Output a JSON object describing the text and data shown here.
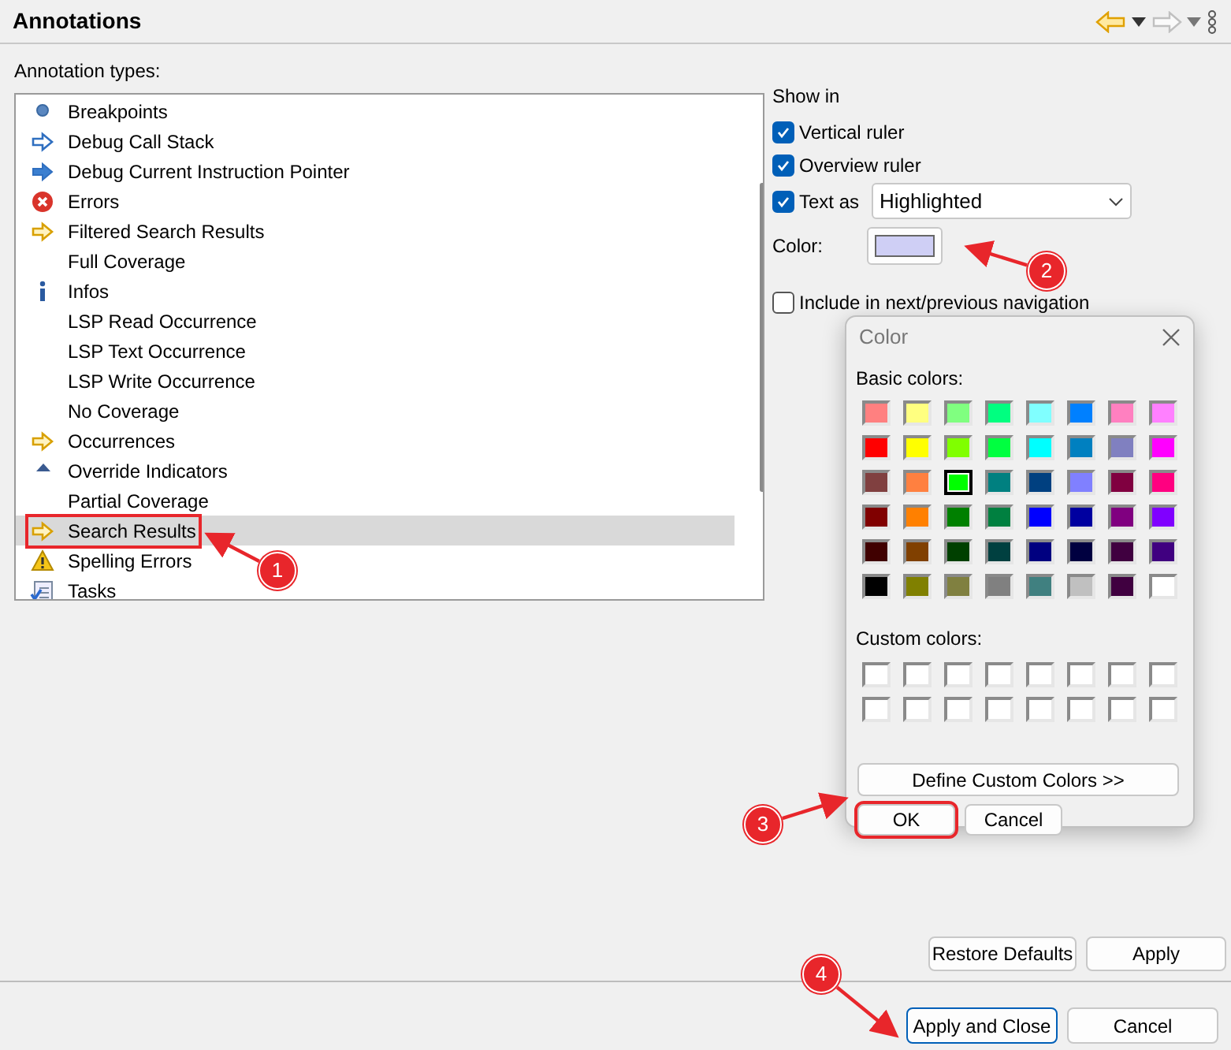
{
  "header": {
    "title": "Annotations"
  },
  "annotation_types": {
    "label": "Annotation types:",
    "items": [
      {
        "label": "Breakpoints",
        "kind": "dot",
        "selected": false,
        "highlighted": false
      },
      {
        "label": "Debug Call Stack",
        "kind": "arrow-outline",
        "selected": false,
        "highlighted": false
      },
      {
        "label": "Debug Current Instruction Pointer",
        "kind": "arrow-filled",
        "selected": false,
        "highlighted": false
      },
      {
        "label": "Errors",
        "kind": "error",
        "selected": false,
        "highlighted": false
      },
      {
        "label": "Filtered Search Results",
        "kind": "arrow-yellow",
        "selected": false,
        "highlighted": false
      },
      {
        "label": "Full Coverage",
        "kind": "plain",
        "selected": false,
        "highlighted": false
      },
      {
        "label": "Infos",
        "kind": "info",
        "selected": false,
        "highlighted": false
      },
      {
        "label": "LSP Read Occurrence",
        "kind": "plain",
        "selected": false,
        "highlighted": false
      },
      {
        "label": "LSP Text Occurrence",
        "kind": "plain",
        "selected": false,
        "highlighted": false
      },
      {
        "label": "LSP Write Occurrence",
        "kind": "plain",
        "selected": false,
        "highlighted": false
      },
      {
        "label": "No Coverage",
        "kind": "plain",
        "selected": false,
        "highlighted": false
      },
      {
        "label": "Occurrences",
        "kind": "arrow-yellow",
        "selected": false,
        "highlighted": false
      },
      {
        "label": "Override Indicators",
        "kind": "triangle",
        "selected": false,
        "highlighted": false
      },
      {
        "label": "Partial Coverage",
        "kind": "plain",
        "selected": false,
        "highlighted": false
      },
      {
        "label": "Search Results",
        "kind": "arrow-yellow",
        "selected": true,
        "highlighted": true
      },
      {
        "label": "Spelling Errors",
        "kind": "warning",
        "selected": false,
        "highlighted": false
      },
      {
        "label": "Tasks",
        "kind": "tasks",
        "selected": false,
        "highlighted": false
      }
    ]
  },
  "show_in": {
    "label": "Show in",
    "options": [
      {
        "kind": "plain",
        "label": "Vertical ruler",
        "checked": true
      },
      {
        "kind": "plain",
        "label": "Overview ruler",
        "checked": true
      },
      {
        "kind": "select",
        "label": "Text as",
        "checked": true,
        "value": "Highlighted"
      }
    ]
  },
  "color": {
    "label": "Color:",
    "color": "#cfcff5"
  },
  "include_navigation": {
    "label": "Include in next/previous navigation",
    "checked": false
  },
  "color_dialog": {
    "title": "Color",
    "basic_colors_label": "Basic colors:",
    "basic_colors": [
      {
        "color": "#ff8080",
        "selected": false
      },
      {
        "color": "#ffff80",
        "selected": false
      },
      {
        "color": "#80ff80",
        "selected": false
      },
      {
        "color": "#00ff80",
        "selected": false
      },
      {
        "color": "#80ffff",
        "selected": false
      },
      {
        "color": "#0080ff",
        "selected": false
      },
      {
        "color": "#ff80c0",
        "selected": false
      },
      {
        "color": "#ff80ff",
        "selected": false
      },
      {
        "color": "#ff0000",
        "selected": false
      },
      {
        "color": "#ffff00",
        "selected": false
      },
      {
        "color": "#80ff00",
        "selected": false
      },
      {
        "color": "#00ff40",
        "selected": false
      },
      {
        "color": "#00ffff",
        "selected": false
      },
      {
        "color": "#0080c0",
        "selected": false
      },
      {
        "color": "#8080c0",
        "selected": false
      },
      {
        "color": "#ff00ff",
        "selected": false
      },
      {
        "color": "#804040",
        "selected": false
      },
      {
        "color": "#ff8040",
        "selected": false
      },
      {
        "color": "#00ff00",
        "selected": true
      },
      {
        "color": "#008080",
        "selected": false
      },
      {
        "color": "#004080",
        "selected": false
      },
      {
        "color": "#8080ff",
        "selected": false
      },
      {
        "color": "#800040",
        "selected": false
      },
      {
        "color": "#ff0080",
        "selected": false
      },
      {
        "color": "#800000",
        "selected": false
      },
      {
        "color": "#ff8000",
        "selected": false
      },
      {
        "color": "#008000",
        "selected": false
      },
      {
        "color": "#008040",
        "selected": false
      },
      {
        "color": "#0000ff",
        "selected": false
      },
      {
        "color": "#0000a0",
        "selected": false
      },
      {
        "color": "#800080",
        "selected": false
      },
      {
        "color": "#8000ff",
        "selected": false
      },
      {
        "color": "#400000",
        "selected": false
      },
      {
        "color": "#804000",
        "selected": false
      },
      {
        "color": "#004000",
        "selected": false
      },
      {
        "color": "#004040",
        "selected": false
      },
      {
        "color": "#000080",
        "selected": false
      },
      {
        "color": "#000040",
        "selected": false
      },
      {
        "color": "#400040",
        "selected": false
      },
      {
        "color": "#400080",
        "selected": false
      },
      {
        "color": "#000000",
        "selected": false
      },
      {
        "color": "#808000",
        "selected": false
      },
      {
        "color": "#808040",
        "selected": false
      },
      {
        "color": "#808080",
        "selected": false
      },
      {
        "color": "#408080",
        "selected": false
      },
      {
        "color": "#c0c0c0",
        "selected": false
      },
      {
        "color": "#400040",
        "selected": false
      },
      {
        "color": "#ffffff",
        "selected": false
      }
    ],
    "custom_colors_label": "Custom colors:",
    "custom_colors": [
      {
        "color": "#ffffff"
      },
      {
        "color": "#ffffff"
      },
      {
        "color": "#ffffff"
      },
      {
        "color": "#ffffff"
      },
      {
        "color": "#ffffff"
      },
      {
        "color": "#ffffff"
      },
      {
        "color": "#ffffff"
      },
      {
        "color": "#ffffff"
      },
      {
        "color": "#ffffff"
      },
      {
        "color": "#ffffff"
      },
      {
        "color": "#ffffff"
      },
      {
        "color": "#ffffff"
      },
      {
        "color": "#ffffff"
      },
      {
        "color": "#ffffff"
      },
      {
        "color": "#ffffff"
      },
      {
        "color": "#ffffff"
      }
    ],
    "define_button": "Define Custom Colors >>",
    "buttons": [
      {
        "label": "OK",
        "highlighted": true
      },
      {
        "label": "Cancel",
        "highlighted": false
      }
    ]
  },
  "page_buttons": [
    {
      "label": "Restore Defaults"
    },
    {
      "label": "Apply"
    }
  ],
  "footer_buttons": [
    {
      "label": "Apply and Close",
      "default": true
    },
    {
      "label": "Cancel",
      "default": false
    }
  ],
  "callouts": [
    {
      "number": "1"
    },
    {
      "number": "2"
    },
    {
      "number": "3"
    },
    {
      "number": "4"
    }
  ]
}
